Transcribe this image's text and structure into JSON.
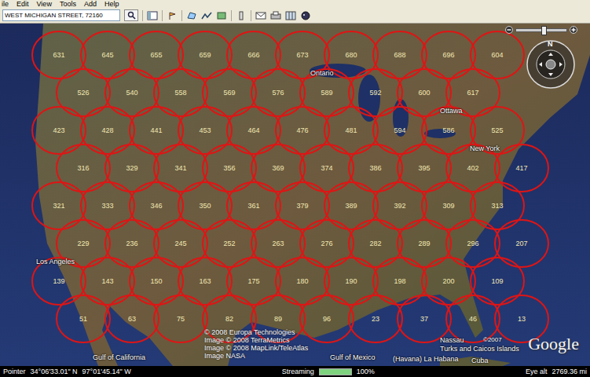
{
  "menu": [
    "ile",
    "Edit",
    "View",
    "Tools",
    "Add",
    "Help"
  ],
  "search": {
    "value": "WEST MICHIGAN STREET, 72160"
  },
  "map": {
    "circles": [
      "631",
      "645",
      "655",
      "659",
      "666",
      "673",
      "680",
      "688",
      "696",
      "604",
      "526",
      "540",
      "558",
      "569",
      "576",
      "589",
      "592",
      "600",
      "617",
      "423",
      "428",
      "441",
      "453",
      "464",
      "476",
      "481",
      "594",
      "586",
      "525",
      "316",
      "329",
      "341",
      "356",
      "369",
      "374",
      "386",
      "395",
      "402",
      "417",
      "321",
      "333",
      "346",
      "350",
      "361",
      "379",
      "389",
      "392",
      "309",
      "313",
      "229",
      "236",
      "245",
      "252",
      "263",
      "276",
      "282",
      "289",
      "296",
      "207",
      "139",
      "143",
      "150",
      "163",
      "175",
      "180",
      "190",
      "198",
      "200",
      "109",
      "51",
      "63",
      "75",
      "82",
      "89",
      "96",
      "23",
      "37",
      "46",
      "13"
    ],
    "labels": [
      "Ontario",
      "Ottawa",
      "New York",
      "Los Angeles",
      "Gulf of California",
      "Gulf of Mexico",
      "(Havana) La Habana",
      "Cuba",
      "Nassau",
      "Turks and Caicos Islands"
    ],
    "attribution": [
      "© 2008 Europa Technologies",
      "Image © 2008 TerraMetrics",
      "Image © 2008 MapLink/TeleAtlas",
      "Image NASA"
    ],
    "logo_copyright": "©2007",
    "logo": "Google",
    "compass": {
      "north": "N"
    },
    "zoom": {
      "level": 0.55
    }
  },
  "status_bar": {
    "pointer_label": "Pointer",
    "lat": "34°06'33.01\" N",
    "lon": "97°01'45.14\" W",
    "streaming_label": "Streaming",
    "streaming_level": 1.0,
    "streaming_reading": "100%",
    "eye_alt_label": "Eye alt",
    "eye_alt": "2769.36 mi"
  }
}
